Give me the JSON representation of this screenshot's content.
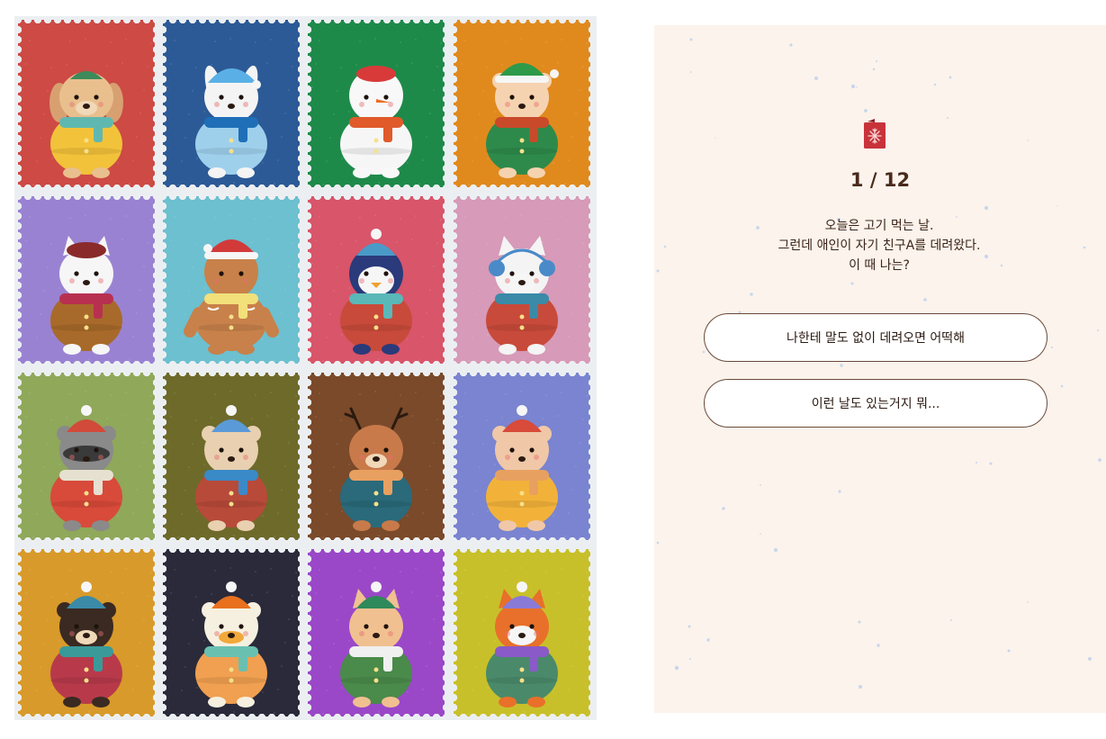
{
  "stamps": [
    {
      "animal": "dog",
      "bg": "#cd4a45",
      "scarf": "#5fb8b0",
      "hat": "#3d8a5a",
      "coat": "#f2c23a",
      "face": "#e9bf8e"
    },
    {
      "animal": "bunny",
      "bg": "#2c5a96",
      "scarf": "#1f6fb8",
      "hat": "#5ab0e6",
      "coat": "#9ed0ec",
      "face": "#f4f4f4"
    },
    {
      "animal": "snowman",
      "bg": "#1e8a4a",
      "scarf": "#e05a2a",
      "hat": "#d83a3a",
      "coat": "#f6f6f6",
      "face": "#f8f8f8"
    },
    {
      "animal": "elf",
      "bg": "#e08a1e",
      "scarf": "#c84a2a",
      "hat": "#2e9a4a",
      "coat": "#2e8a4a",
      "face": "#f6d3b0"
    },
    {
      "animal": "cat",
      "bg": "#9a82d2",
      "scarf": "#b83050",
      "hat": "#8a2a2a",
      "coat": "#a86a2a",
      "face": "#f6f6f6"
    },
    {
      "animal": "gingerbread",
      "bg": "#6cc0d0",
      "scarf": "#f2e07a",
      "hat": "#d23a3a",
      "coat": "#c8814a",
      "face": "#c8814a"
    },
    {
      "animal": "penguin",
      "bg": "#d8556a",
      "scarf": "#5ab8b8",
      "hat": "#4a9ac8",
      "coat": "#c84a3a",
      "face": "#2a3a7a"
    },
    {
      "animal": "husky",
      "bg": "#d79ab8",
      "scarf": "#3a8aa8",
      "hat": "#4a8ac8",
      "coat": "#c84a3a",
      "face": "#f4f4f4"
    },
    {
      "animal": "raccoon",
      "bg": "#8fa85a",
      "scarf": "#e6e0d0",
      "hat": "#d24a3a",
      "coat": "#d84a3a",
      "face": "#8a8a8a"
    },
    {
      "animal": "otter",
      "bg": "#6e6a2a",
      "scarf": "#3a8ac8",
      "hat": "#5a9ad8",
      "coat": "#b84a3a",
      "face": "#e8d0b0"
    },
    {
      "animal": "deer",
      "bg": "#7a4a2a",
      "scarf": "#e8a060",
      "hat": "#2a1a10",
      "coat": "#2a6a7a",
      "face": "#c87a4a"
    },
    {
      "animal": "hedgehog",
      "bg": "#7a84d0",
      "scarf": "#e8a060",
      "hat": "#d84a3a",
      "coat": "#f2b23a",
      "face": "#f0c8a8"
    },
    {
      "animal": "bear",
      "bg": "#d89a2a",
      "scarf": "#3a9a9a",
      "hat": "#3a8aa8",
      "coat": "#b83a4a",
      "face": "#3a2a22"
    },
    {
      "animal": "duck",
      "bg": "#2a2a3a",
      "scarf": "#6ac0b0",
      "hat": "#e8701e",
      "coat": "#f0a050",
      "face": "#f6f0e0"
    },
    {
      "animal": "owl",
      "bg": "#9a48c8",
      "scarf": "#f0f0f0",
      "hat": "#2e8a5a",
      "coat": "#4a8a4a",
      "face": "#f0c090"
    },
    {
      "animal": "fox",
      "bg": "#c8c02a",
      "scarf": "#8a5ac8",
      "hat": "#8a7ad8",
      "coat": "#4a8a6a",
      "face": "#e8702a"
    }
  ],
  "quiz": {
    "counter": "1 / 12",
    "question_lines": [
      "오늘은 고기 먹는 날.",
      "그런데 애인이 자기 친구A를 데려왔다.",
      "이 때 나는?"
    ],
    "answers": [
      "나한테 말도 없이 데려오면 어떡해",
      "이런 날도 있는거지 뭐..."
    ],
    "icon": "christmas-card-snowflake-icon",
    "accent": "#c8333a",
    "panel_bg": "#fbf3ec"
  }
}
